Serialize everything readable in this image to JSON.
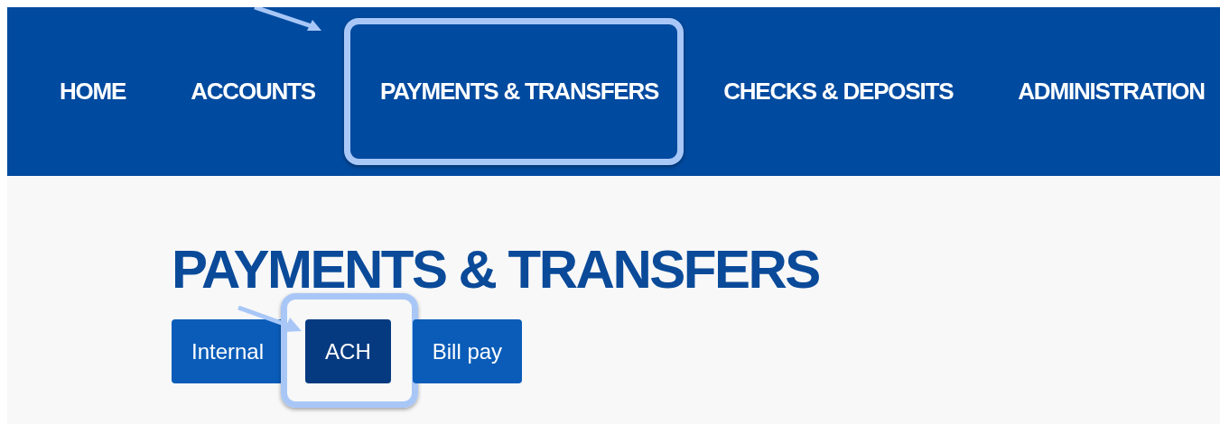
{
  "nav": {
    "items": [
      {
        "label": "HOME",
        "highlighted": false
      },
      {
        "label": "ACCOUNTS",
        "highlighted": false
      },
      {
        "label": "PAYMENTS & TRANSFERS",
        "highlighted": true
      },
      {
        "label": "CHECKS & DEPOSITS",
        "highlighted": false
      },
      {
        "label": "ADMINISTRATION",
        "highlighted": false
      }
    ]
  },
  "page": {
    "title": "PAYMENTS & TRANSFERS",
    "tabs": [
      {
        "label": "Internal",
        "selected": false,
        "highlighted": false
      },
      {
        "label": "ACH",
        "selected": true,
        "highlighted": true
      },
      {
        "label": "Bill pay",
        "selected": false,
        "highlighted": false
      }
    ]
  }
}
